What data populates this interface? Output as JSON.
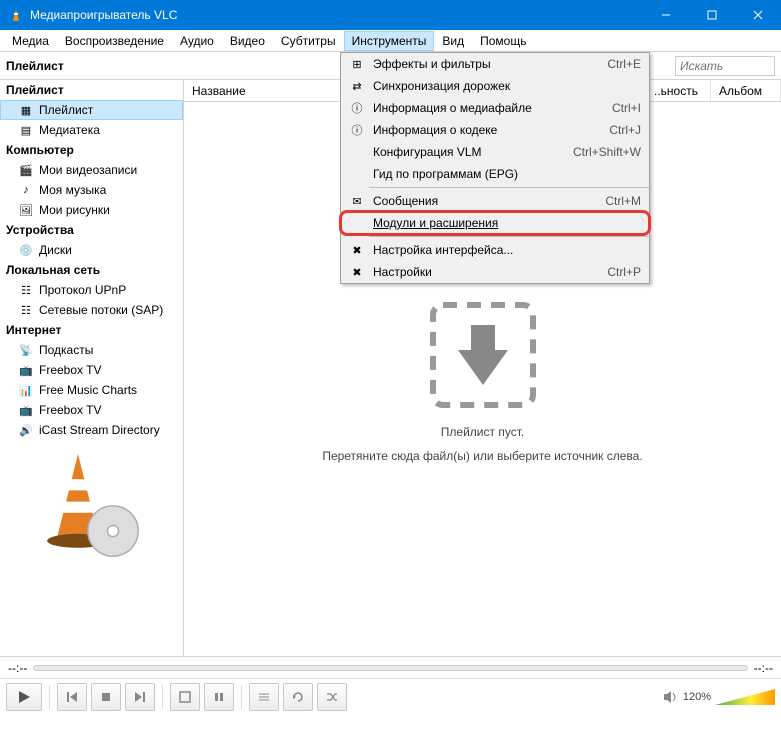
{
  "title": "Медиапроигрыватель VLC",
  "menubar": [
    "Медиа",
    "Воспроизведение",
    "Аудио",
    "Видео",
    "Субтитры",
    "Инструменты",
    "Вид",
    "Помощь"
  ],
  "active_menu_index": 5,
  "toolbar": {
    "title": "Плейлист",
    "search_placeholder": "Искать"
  },
  "sidebar": {
    "groups": [
      {
        "label": "Плейлист",
        "items": [
          {
            "label": "Плейлист",
            "icon": "playlist",
            "selected": true
          },
          {
            "label": "Медиатека",
            "icon": "library"
          }
        ]
      },
      {
        "label": "Компьютер",
        "items": [
          {
            "label": "Мои видеозаписи",
            "icon": "video"
          },
          {
            "label": "Моя музыка",
            "icon": "music"
          },
          {
            "label": "Мои рисунки",
            "icon": "pictures"
          }
        ]
      },
      {
        "label": "Устройства",
        "items": [
          {
            "label": "Диски",
            "icon": "disc"
          }
        ]
      },
      {
        "label": "Локальная сеть",
        "items": [
          {
            "label": "Протокол UPnP",
            "icon": "upnp"
          },
          {
            "label": "Сетевые потоки (SAP)",
            "icon": "sap"
          }
        ]
      },
      {
        "label": "Интернет",
        "items": [
          {
            "label": "Подкасты",
            "icon": "podcast"
          },
          {
            "label": "Freebox TV",
            "icon": "freebox"
          },
          {
            "label": "Free Music Charts",
            "icon": "charts"
          },
          {
            "label": "Freebox TV",
            "icon": "freebox"
          },
          {
            "label": "iCast Stream Directory",
            "icon": "stream"
          }
        ]
      }
    ]
  },
  "list_columns": [
    "Название",
    "..ьность",
    "Альбом"
  ],
  "empty": {
    "line1": "Плейлист пуст.",
    "line2": "Перетяните сюда файл(ы) или выберите источник слева."
  },
  "dropdown": [
    {
      "icon": "fx",
      "label": "Эффекты и фильтры",
      "shortcut": "Ctrl+E"
    },
    {
      "icon": "sync",
      "label": "Синхронизация дорожек"
    },
    {
      "icon": "info",
      "label": "Информация о медиафайле",
      "shortcut": "Ctrl+I"
    },
    {
      "icon": "info",
      "label": "Информация о кодеке",
      "shortcut": "Ctrl+J"
    },
    {
      "label": "Конфигурация VLM",
      "shortcut": "Ctrl+Shift+W"
    },
    {
      "label": "Гид по программам (EPG)"
    },
    {
      "sep": true
    },
    {
      "icon": "msg",
      "label": "Сообщения",
      "shortcut": "Ctrl+M"
    },
    {
      "label": "Модули и расширения",
      "highlighted": true
    },
    {
      "sep": true
    },
    {
      "icon": "tools",
      "label": "Настройка интерфейса..."
    },
    {
      "icon": "tools",
      "label": "Настройки",
      "shortcut": "Ctrl+P"
    }
  ],
  "seek": {
    "left": "--:--",
    "right": "--:--"
  },
  "volume": {
    "pct": "120%"
  }
}
